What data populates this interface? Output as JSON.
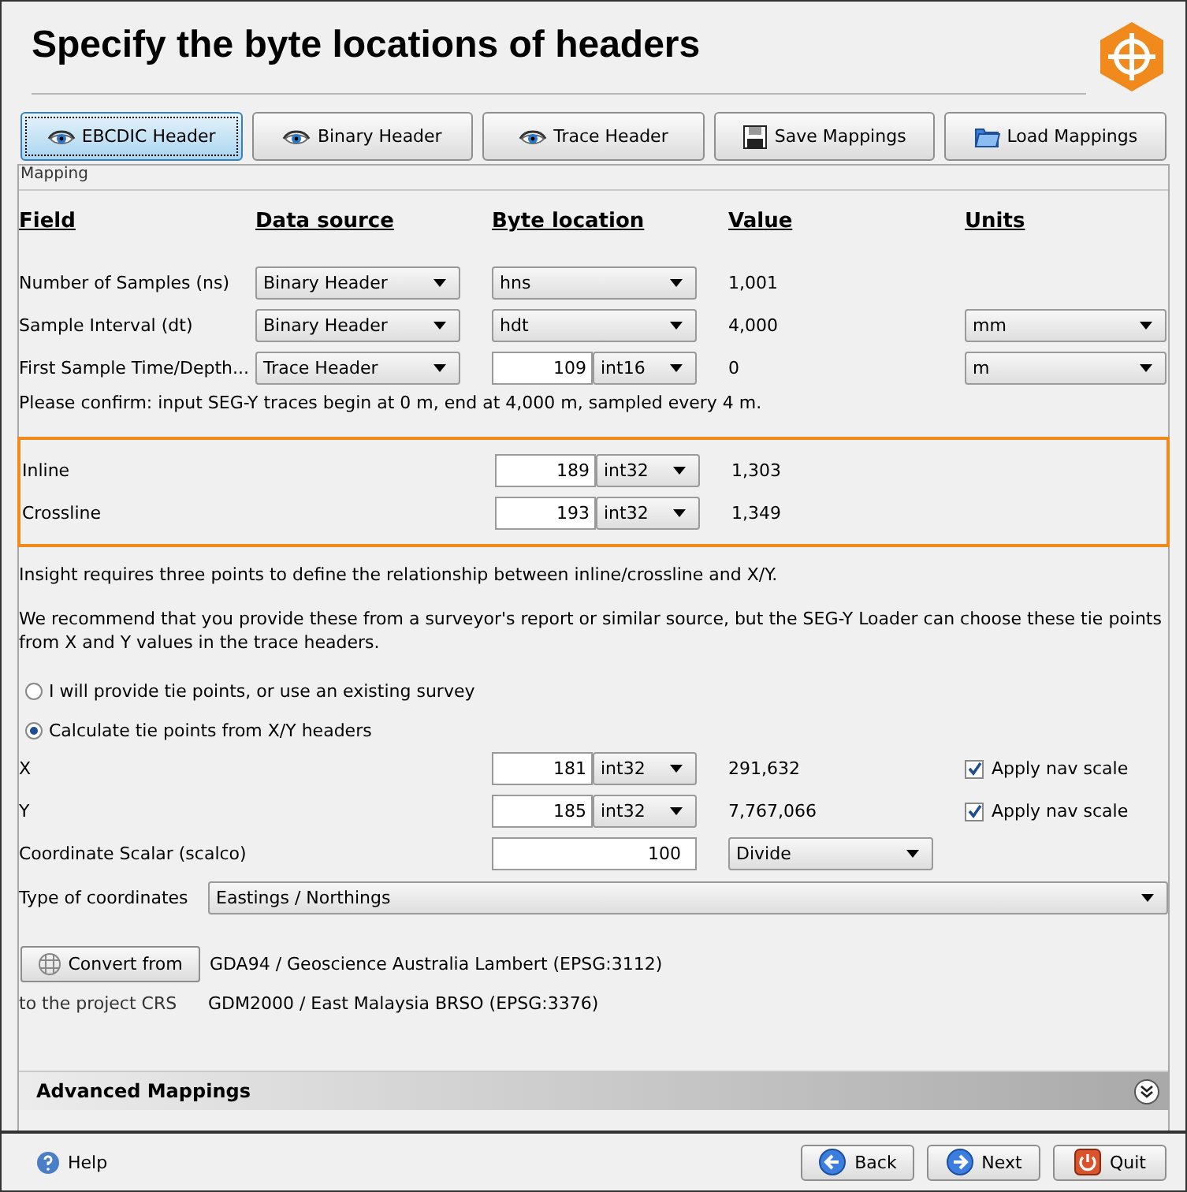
{
  "title": "Specify the byte locations of headers",
  "toolbar": [
    {
      "label": "EBCDIC Header",
      "kind": "view",
      "selected": true
    },
    {
      "label": "Binary Header",
      "kind": "view",
      "selected": false
    },
    {
      "label": "Trace Header",
      "kind": "view",
      "selected": false
    },
    {
      "label": "Save Mappings",
      "kind": "save",
      "selected": false
    },
    {
      "label": "Load Mappings",
      "kind": "load",
      "selected": false
    }
  ],
  "mapping": {
    "title": "Mapping",
    "columns": [
      "Field",
      "Data source",
      "Byte location",
      "Value",
      "Units"
    ],
    "rows": [
      {
        "field": "Number of Samples (ns)",
        "source": "Binary Header",
        "byte": {
          "kind": "dropdown",
          "value": "hns"
        },
        "value": "1,001"
      },
      {
        "field": "Sample Interval (dt)",
        "source": "Binary Header",
        "byte": {
          "kind": "dropdown",
          "value": "hdt"
        },
        "value": "4,000",
        "units": "mm"
      },
      {
        "field": "First Sample Time/Depth...",
        "source": "Trace Header",
        "byte": {
          "kind": "field",
          "value": "109",
          "type": "int16"
        },
        "value": "0",
        "units": "m"
      }
    ],
    "confirm": "Please confirm: input SEG-Y traces begin at 0 m, end at 4,000 m, sampled every 4 m.",
    "highlighted_rows": [
      {
        "field": "Inline",
        "byte": {
          "kind": "field",
          "value": "189",
          "type": "int32"
        },
        "value": "1,303"
      },
      {
        "field": "Crossline",
        "byte": {
          "kind": "field",
          "value": "193",
          "type": "int32"
        },
        "value": "1,349"
      }
    ],
    "info": [
      "Insight requires three points to define the relationship between inline/crossline and X/Y.",
      "We recommend that you provide these from a surveyor's report or similar source, but the SEG-Y Loader can choose these tie points from X and Y values in the trace headers."
    ],
    "tie_options": [
      {
        "label": "I will provide tie points, or use an existing survey",
        "selected": false
      },
      {
        "label": "Calculate tie points from X/Y headers",
        "selected": true
      }
    ],
    "xy_rows": [
      {
        "field": "X",
        "byte": {
          "kind": "field",
          "value": "181",
          "type": "int32"
        },
        "value": "291,632",
        "nav_scale": {
          "label": "Apply nav scale",
          "checked": true
        }
      },
      {
        "field": "Y",
        "byte": {
          "kind": "field",
          "value": "185",
          "type": "int32"
        },
        "value": "7,767,066",
        "nav_scale": {
          "label": "Apply nav scale",
          "checked": true
        }
      }
    ],
    "scalar": {
      "label": "Coordinate Scalar (scalco)",
      "value": "100",
      "mode": "Divide"
    },
    "coord_type": {
      "label": "Type of coordinates",
      "value": "Eastings / Northings"
    },
    "convert": {
      "button": "Convert from",
      "from": "GDA94 / Geoscience Australia Lambert (EPSG:3112)",
      "to_label": "to the project CRS",
      "to": "GDM2000 / East Malaysia BRSO (EPSG:3376)"
    },
    "advanced": {
      "label": "Advanced Mappings",
      "expanded": false
    }
  },
  "footer": {
    "help": "Help",
    "buttons": [
      {
        "label": "Back",
        "kind": "back"
      },
      {
        "label": "Next",
        "kind": "next"
      },
      {
        "label": "Quit",
        "kind": "quit"
      }
    ]
  }
}
